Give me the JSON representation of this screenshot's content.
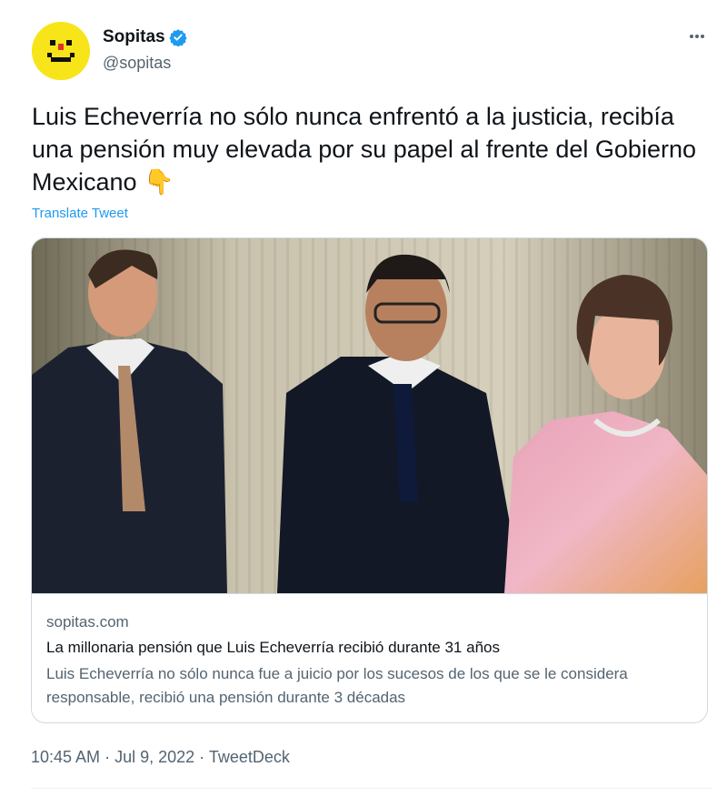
{
  "author": {
    "display_name": "Sopitas",
    "handle": "@sopitas",
    "verified": true,
    "avatar_icon": "sopitas-smiley-logo",
    "avatar_color": "#f7e51a"
  },
  "tweet": {
    "text": "Luis Echeverría no sólo nunca enfrentó a la justicia, recibía una pensión muy elevada por su papel al frente del Gobierno Mexicano",
    "emoji": "👇",
    "translate_label": "Translate Tweet"
  },
  "link_card": {
    "domain": "sopitas.com",
    "title": "La millonaria pensión que Luis Echeverría recibió durante 31 años",
    "description": "Luis Echeverría no sólo nunca fue a juicio por los sucesos de los que se le considera responsable, recibió una pensión durante 3 décadas"
  },
  "meta": {
    "time": "10:45 AM",
    "separator": " · ",
    "date": "Jul 9, 2022",
    "source": "TweetDeck"
  },
  "colors": {
    "accent": "#1d9bf0",
    "secondary_text": "#536471",
    "primary_text": "#0f1419",
    "border": "#cfd9de"
  }
}
